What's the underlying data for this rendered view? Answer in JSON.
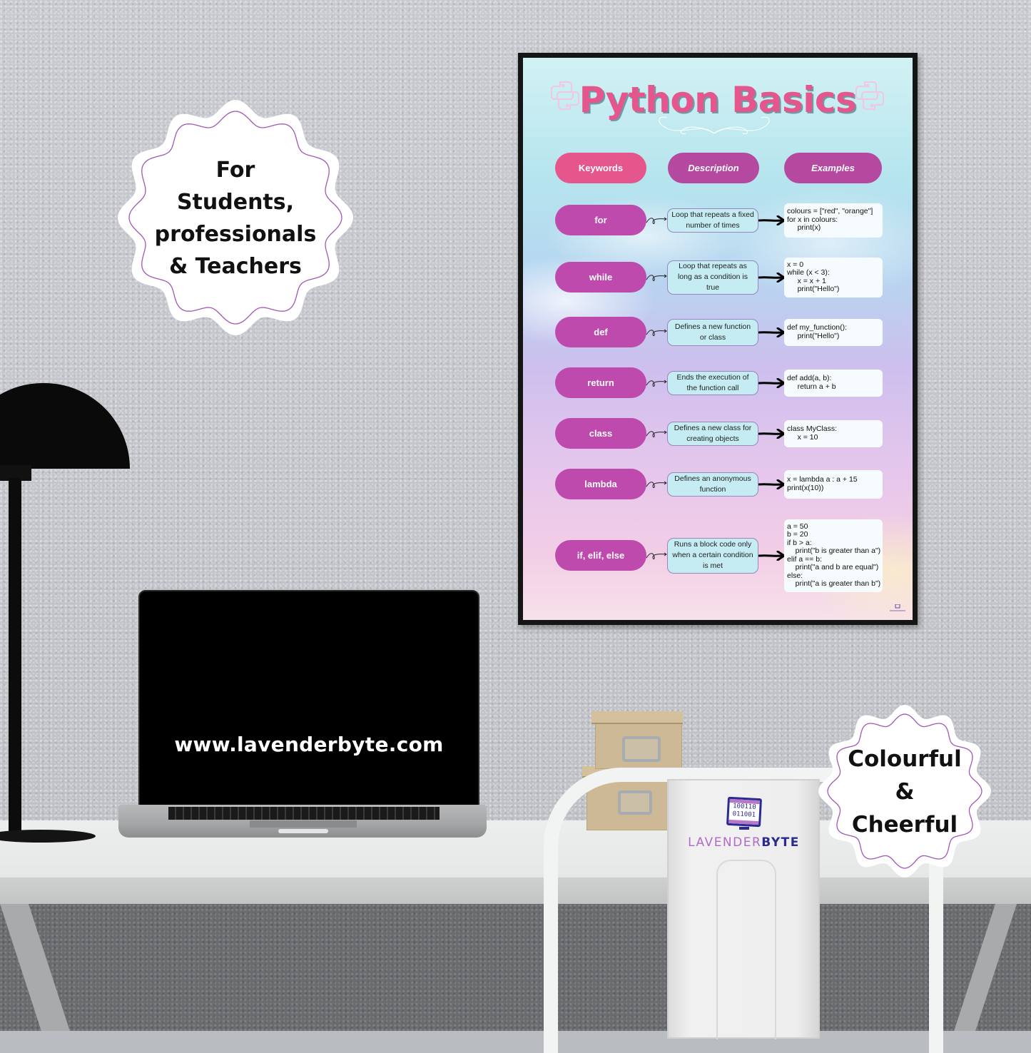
{
  "poster": {
    "title": "Python Basics",
    "headers": {
      "keywords": "Keywords",
      "description": "Description",
      "examples": "Examples"
    },
    "rows": [
      {
        "keyword": "for",
        "description": "Loop that repeats a fixed number of times",
        "example": "colours = [\"red\", \"orange\"]\nfor x in colours:\n     print(x)"
      },
      {
        "keyword": "while",
        "description": "Loop that repeats as long as a condition is true",
        "example": "x = 0\nwhile (x < 3):\n     x = x + 1\n     print(\"Hello\")"
      },
      {
        "keyword": "def",
        "description": "Defines a new function or class",
        "example": "def my_function():\n     print(\"Hello\")"
      },
      {
        "keyword": "return",
        "description": "Ends the execution of the function call",
        "example": "def add(a, b):\n     return a + b"
      },
      {
        "keyword": "class",
        "description": "Defines a new class for creating objects",
        "example": "class MyClass:\n     x = 10"
      },
      {
        "keyword": "lambda",
        "description": "Defines an anonymous function",
        "example": "x = lambda a : a + 15\nprint(x(10))"
      },
      {
        "keyword": "if, elif, else",
        "description": "Runs a block code only when a certain condition is met",
        "example": "a = 50\nb = 20\nif b > a:\n    print(\"b is greater than a\")\nelif a == b:\n    print(\"a and b are equal\")\nelse:\n    print(\"a is greater than b\")"
      }
    ],
    "colors": {
      "title": "#e5578c",
      "keyword_header": "#e5578c",
      "column_header": "#b5489f",
      "keyword_pill": "#be4aad",
      "description_box": "#c4ecf2"
    }
  },
  "badges": {
    "audience": [
      "For",
      "Students,",
      "professionals",
      "& Teachers"
    ],
    "style": [
      "Colourful",
      "&",
      "Cheerful"
    ]
  },
  "laptop": {
    "url": "www.lavenderbyte.com"
  },
  "brand": {
    "name_part1": "LAVENDER",
    "name_part2": "BYTE",
    "monitor_line1": "100110",
    "monitor_line2": "011001",
    "colors": {
      "lavender": "#b06cc6",
      "navy": "#2b2a8f"
    }
  }
}
